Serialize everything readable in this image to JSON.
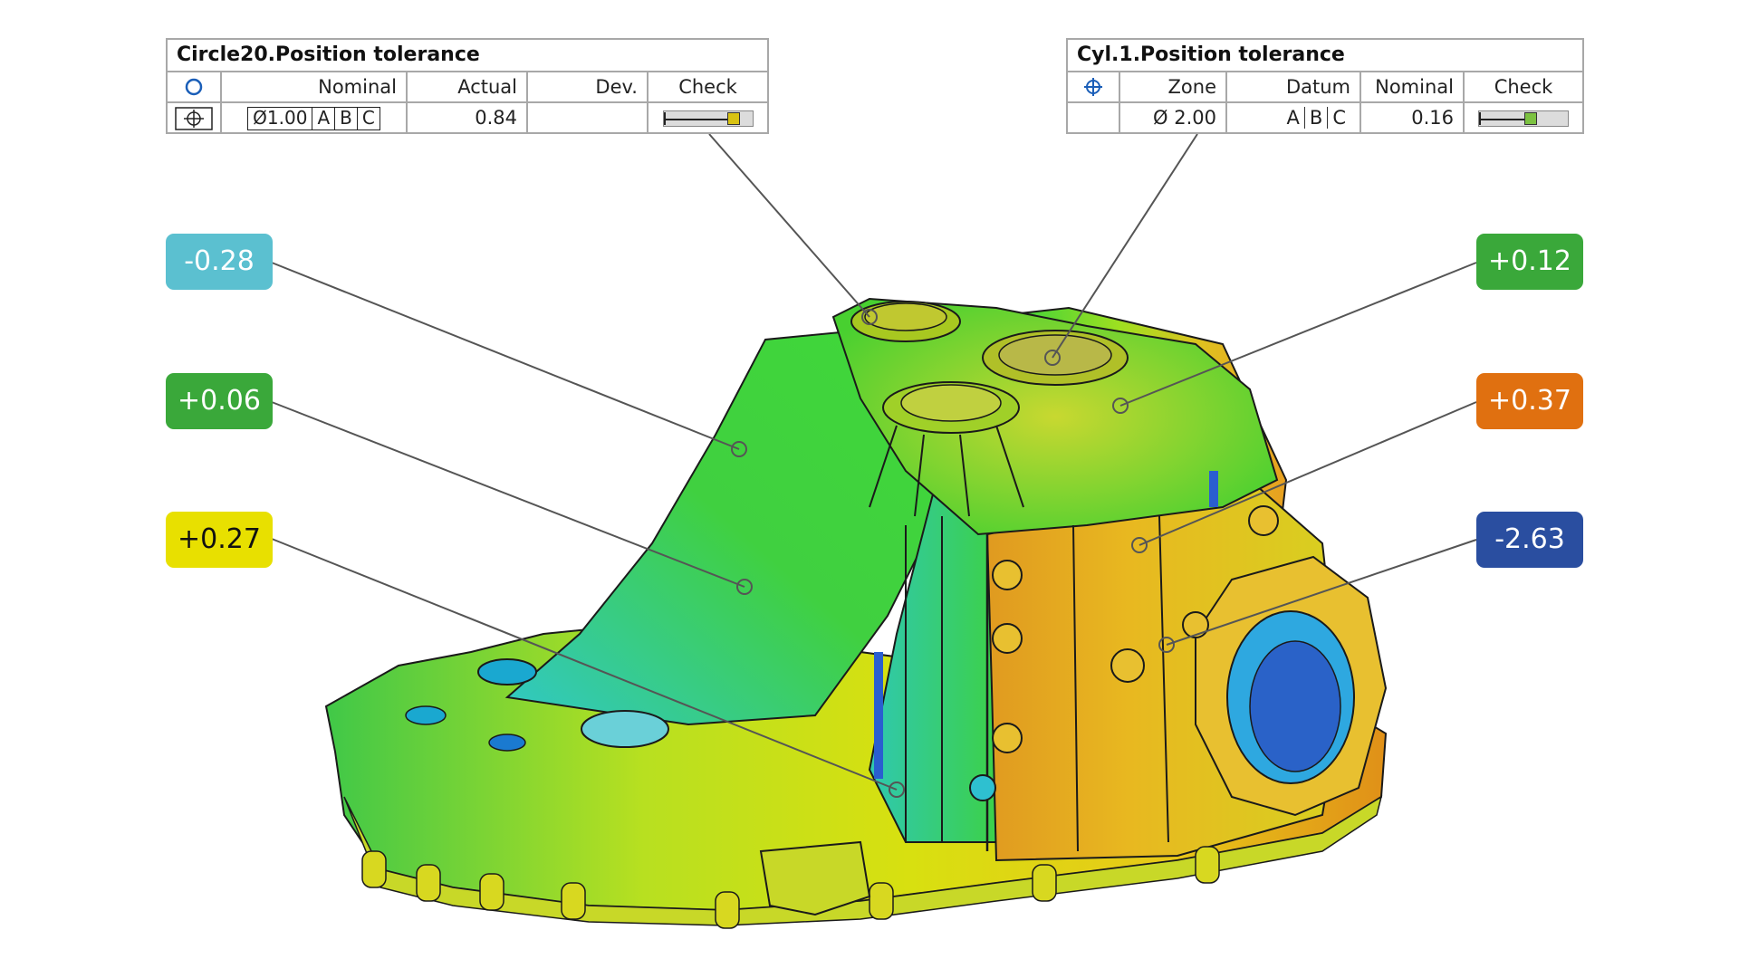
{
  "left_table": {
    "title": "Circle20.Position tolerance",
    "header_icon": "circle-icon",
    "headers": [
      "Nominal",
      "Actual",
      "Dev.",
      "Check"
    ],
    "row_icon": "position-icon",
    "nominal_diameter": "Ø1.00",
    "datums": [
      "A",
      "B",
      "C"
    ],
    "actual": "0.84",
    "dev": "",
    "check_level": 0.84,
    "check_color": "#d9c313"
  },
  "right_table": {
    "title": "Cyl.1.Position tolerance",
    "header_icon": "position-icon",
    "headers": [
      "Zone",
      "Datum",
      "Nominal",
      "Check"
    ],
    "zone": "Ø 2.00",
    "datums": [
      "A",
      "B",
      "C"
    ],
    "nominal": "0.16",
    "check_level": 0.6,
    "check_color": "#7cc241"
  },
  "labels": {
    "l1": {
      "text": "-0.28",
      "color": "#5bc0d0"
    },
    "l2": {
      "text": "+0.06",
      "color": "#3aa83a"
    },
    "l3": {
      "text": "+0.27",
      "color": "#e8e000"
    },
    "r1": {
      "text": "+0.12",
      "color": "#3aa83a"
    },
    "r2": {
      "text": "+0.37",
      "color": "#e07010"
    },
    "r3": {
      "text": "-2.63",
      "color": "#2a4ea0"
    }
  },
  "model": {
    "part": "gearbox-housing",
    "color_scale": [
      "#1a4bd0",
      "#20c0e0",
      "#30d040",
      "#c8e020",
      "#f0a020",
      "#d02010"
    ]
  }
}
